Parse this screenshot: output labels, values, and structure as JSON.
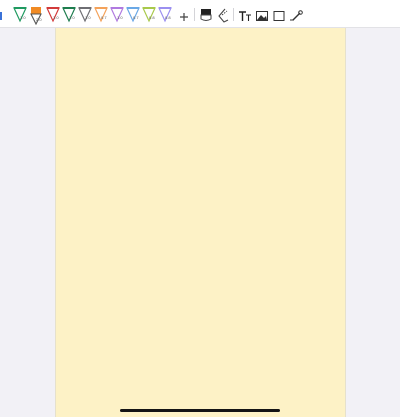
{
  "toolbar": {
    "pens": [
      {
        "name": "pen-green",
        "color": "#1f9a60",
        "size_label": "1.0"
      },
      {
        "name": "pen-orange-selected",
        "color": "#f08a24",
        "size_label": "2.0",
        "selected": true
      },
      {
        "name": "pen-red",
        "color": "#d23a3a",
        "size_label": "1.0"
      },
      {
        "name": "pen-dark-green",
        "color": "#1e7d4e",
        "size_label": "1.0"
      },
      {
        "name": "pen-gray",
        "color": "#6e6e73",
        "size_label": "1.0"
      },
      {
        "name": "pen-light-orange",
        "color": "#f4a25a",
        "size_label": "0.7"
      },
      {
        "name": "pen-purple",
        "color": "#b07ae0",
        "size_label": "1.0"
      },
      {
        "name": "pen-light-blue",
        "color": "#6aa8e6",
        "size_label": "0.7"
      },
      {
        "name": "pen-yellow-green",
        "color": "#a8c94a",
        "size_label": "0.8"
      },
      {
        "name": "pen-lavender",
        "color": "#9b8ff0",
        "size_label": "0.8"
      }
    ],
    "add_icon": "plus-icon",
    "eraser_icon": "eraser-icon",
    "lasso_icon": "lasso-icon",
    "text_icon": "text-icon",
    "image_icon": "image-icon",
    "shape_icon": "rectangle-icon",
    "pointer_icon": "laser-pointer-icon",
    "text_label": "T"
  },
  "colors": {
    "paper": "#fdf2c6",
    "background": "#f2f1f6"
  }
}
